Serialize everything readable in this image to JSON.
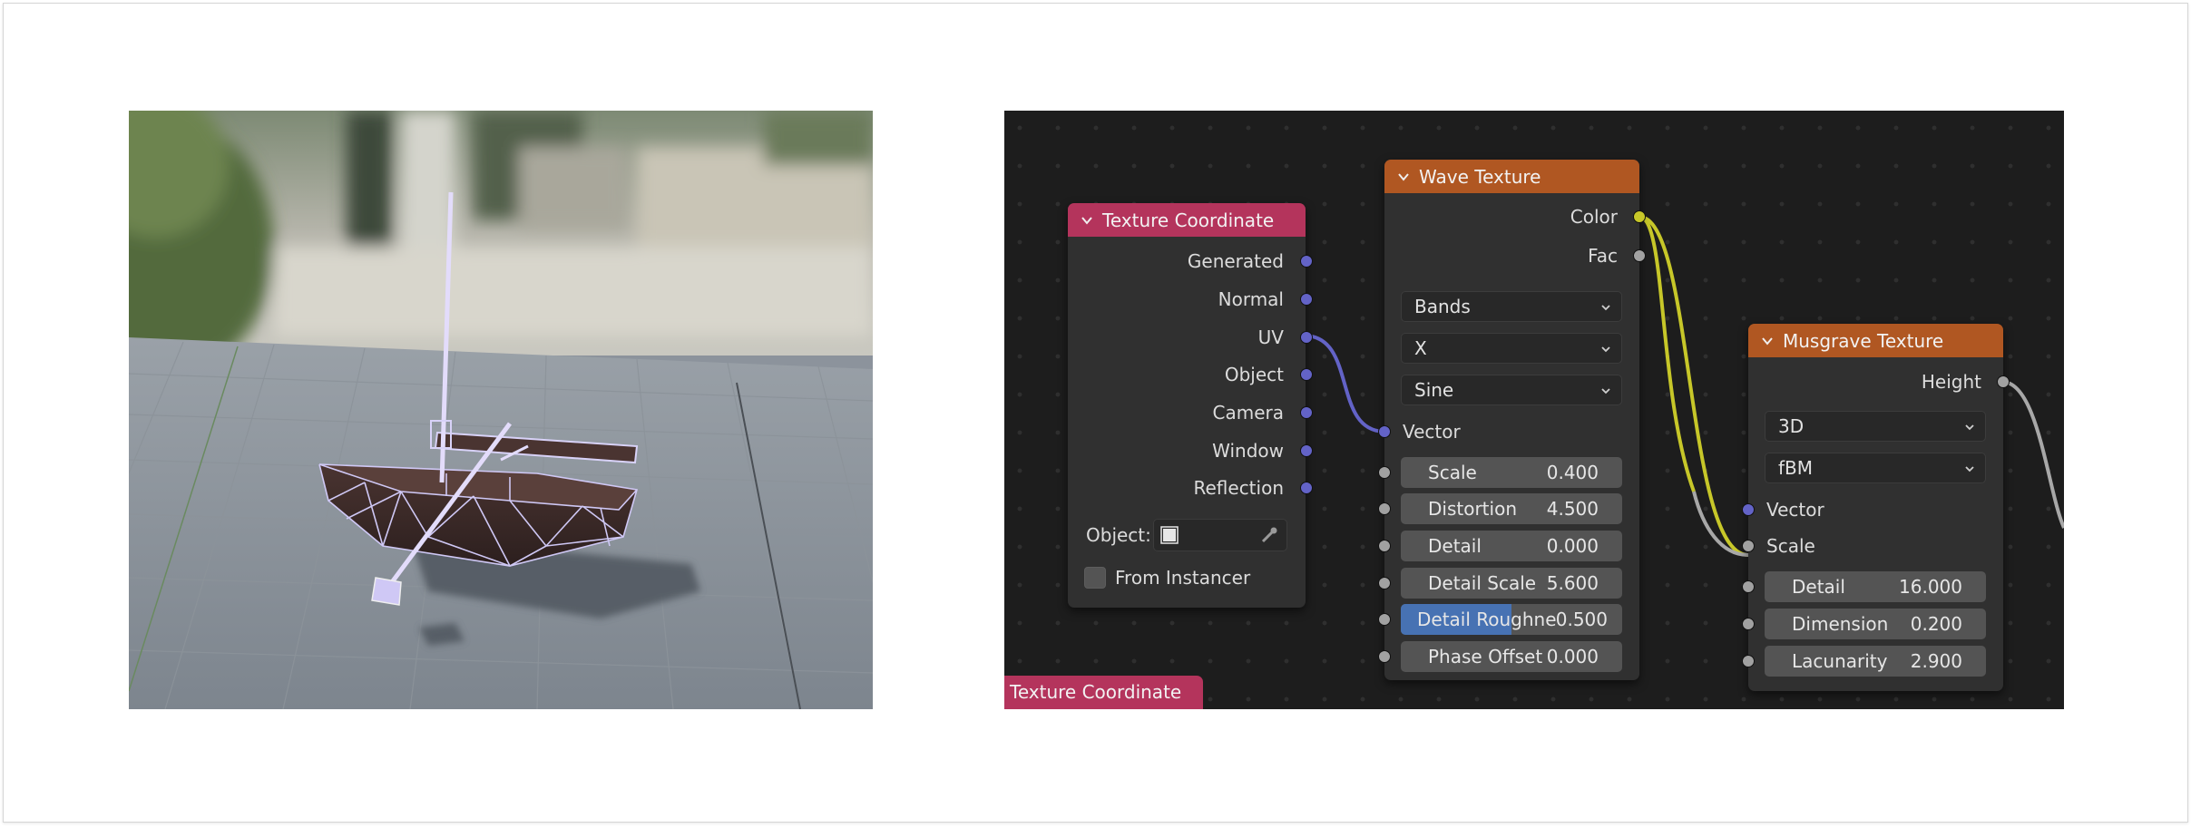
{
  "render": {
    "alt": "Rendered boat model with wireframe overlay"
  },
  "texture_coordinate": {
    "title": "Texture Coordinate",
    "outputs": [
      "Generated",
      "Normal",
      "UV",
      "Object",
      "Camera",
      "Window",
      "Reflection"
    ],
    "object_label": "Object:",
    "from_instancer_label": "From Instancer"
  },
  "wave_texture": {
    "title": "Wave Texture",
    "outputs": [
      "Color",
      "Fac"
    ],
    "dropdowns": [
      "Bands",
      "X",
      "Sine"
    ],
    "vector_label": "Vector",
    "fields": [
      {
        "label": "Scale",
        "value": "0.400"
      },
      {
        "label": "Distortion",
        "value": "4.500"
      },
      {
        "label": "Detail",
        "value": "0.000"
      },
      {
        "label": "Detail Scale",
        "value": "5.600"
      },
      {
        "label": "Detail Roughne",
        "value": "0.500",
        "fill": 0.5
      },
      {
        "label": "Phase Offset",
        "value": "0.000"
      }
    ]
  },
  "musgrave_texture": {
    "title": "Musgrave Texture",
    "outputs": [
      "Height"
    ],
    "dropdowns": [
      "3D",
      "fBM"
    ],
    "vector_label": "Vector",
    "scale_label": "Scale",
    "fields": [
      {
        "label": "Detail",
        "value": "16.000"
      },
      {
        "label": "Dimension",
        "value": "0.200"
      },
      {
        "label": "Lacunarity",
        "value": "2.900"
      }
    ]
  },
  "frame": {
    "label": "Texture Coordinate"
  },
  "colors": {
    "texture_header": "#b4345c",
    "texture_node_header": "#b05722",
    "vector_socket": "#6363c7",
    "color_socket": "#c7c729",
    "float_socket": "#a1a1a1",
    "slider_fill": "#4772b3"
  }
}
